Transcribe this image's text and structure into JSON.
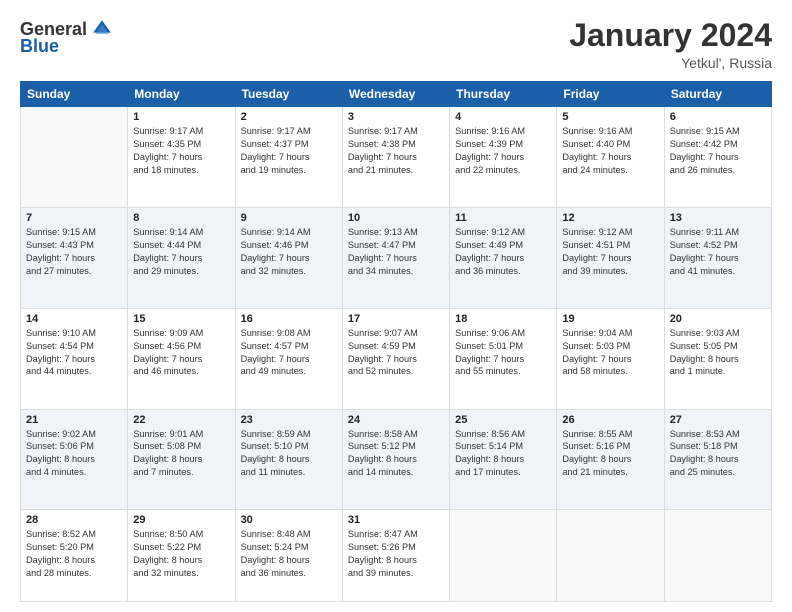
{
  "logo": {
    "general": "General",
    "blue": "Blue"
  },
  "title": "January 2024",
  "location": "Yetkul', Russia",
  "days_header": [
    "Sunday",
    "Monday",
    "Tuesday",
    "Wednesday",
    "Thursday",
    "Friday",
    "Saturday"
  ],
  "weeks": [
    [
      {
        "num": "",
        "info": ""
      },
      {
        "num": "1",
        "info": "Sunrise: 9:17 AM\nSunset: 4:35 PM\nDaylight: 7 hours\nand 18 minutes."
      },
      {
        "num": "2",
        "info": "Sunrise: 9:17 AM\nSunset: 4:37 PM\nDaylight: 7 hours\nand 19 minutes."
      },
      {
        "num": "3",
        "info": "Sunrise: 9:17 AM\nSunset: 4:38 PM\nDaylight: 7 hours\nand 21 minutes."
      },
      {
        "num": "4",
        "info": "Sunrise: 9:16 AM\nSunset: 4:39 PM\nDaylight: 7 hours\nand 22 minutes."
      },
      {
        "num": "5",
        "info": "Sunrise: 9:16 AM\nSunset: 4:40 PM\nDaylight: 7 hours\nand 24 minutes."
      },
      {
        "num": "6",
        "info": "Sunrise: 9:15 AM\nSunset: 4:42 PM\nDaylight: 7 hours\nand 26 minutes."
      }
    ],
    [
      {
        "num": "7",
        "info": "Sunrise: 9:15 AM\nSunset: 4:43 PM\nDaylight: 7 hours\nand 27 minutes."
      },
      {
        "num": "8",
        "info": "Sunrise: 9:14 AM\nSunset: 4:44 PM\nDaylight: 7 hours\nand 29 minutes."
      },
      {
        "num": "9",
        "info": "Sunrise: 9:14 AM\nSunset: 4:46 PM\nDaylight: 7 hours\nand 32 minutes."
      },
      {
        "num": "10",
        "info": "Sunrise: 9:13 AM\nSunset: 4:47 PM\nDaylight: 7 hours\nand 34 minutes."
      },
      {
        "num": "11",
        "info": "Sunrise: 9:12 AM\nSunset: 4:49 PM\nDaylight: 7 hours\nand 36 minutes."
      },
      {
        "num": "12",
        "info": "Sunrise: 9:12 AM\nSunset: 4:51 PM\nDaylight: 7 hours\nand 39 minutes."
      },
      {
        "num": "13",
        "info": "Sunrise: 9:11 AM\nSunset: 4:52 PM\nDaylight: 7 hours\nand 41 minutes."
      }
    ],
    [
      {
        "num": "14",
        "info": "Sunrise: 9:10 AM\nSunset: 4:54 PM\nDaylight: 7 hours\nand 44 minutes."
      },
      {
        "num": "15",
        "info": "Sunrise: 9:09 AM\nSunset: 4:56 PM\nDaylight: 7 hours\nand 46 minutes."
      },
      {
        "num": "16",
        "info": "Sunrise: 9:08 AM\nSunset: 4:57 PM\nDaylight: 7 hours\nand 49 minutes."
      },
      {
        "num": "17",
        "info": "Sunrise: 9:07 AM\nSunset: 4:59 PM\nDaylight: 7 hours\nand 52 minutes."
      },
      {
        "num": "18",
        "info": "Sunrise: 9:06 AM\nSunset: 5:01 PM\nDaylight: 7 hours\nand 55 minutes."
      },
      {
        "num": "19",
        "info": "Sunrise: 9:04 AM\nSunset: 5:03 PM\nDaylight: 7 hours\nand 58 minutes."
      },
      {
        "num": "20",
        "info": "Sunrise: 9:03 AM\nSunset: 5:05 PM\nDaylight: 8 hours\nand 1 minute."
      }
    ],
    [
      {
        "num": "21",
        "info": "Sunrise: 9:02 AM\nSunset: 5:06 PM\nDaylight: 8 hours\nand 4 minutes."
      },
      {
        "num": "22",
        "info": "Sunrise: 9:01 AM\nSunset: 5:08 PM\nDaylight: 8 hours\nand 7 minutes."
      },
      {
        "num": "23",
        "info": "Sunrise: 8:59 AM\nSunset: 5:10 PM\nDaylight: 8 hours\nand 11 minutes."
      },
      {
        "num": "24",
        "info": "Sunrise: 8:58 AM\nSunset: 5:12 PM\nDaylight: 8 hours\nand 14 minutes."
      },
      {
        "num": "25",
        "info": "Sunrise: 8:56 AM\nSunset: 5:14 PM\nDaylight: 8 hours\nand 17 minutes."
      },
      {
        "num": "26",
        "info": "Sunrise: 8:55 AM\nSunset: 5:16 PM\nDaylight: 8 hours\nand 21 minutes."
      },
      {
        "num": "27",
        "info": "Sunrise: 8:53 AM\nSunset: 5:18 PM\nDaylight: 8 hours\nand 25 minutes."
      }
    ],
    [
      {
        "num": "28",
        "info": "Sunrise: 8:52 AM\nSunset: 5:20 PM\nDaylight: 8 hours\nand 28 minutes."
      },
      {
        "num": "29",
        "info": "Sunrise: 8:50 AM\nSunset: 5:22 PM\nDaylight: 8 hours\nand 32 minutes."
      },
      {
        "num": "30",
        "info": "Sunrise: 8:48 AM\nSunset: 5:24 PM\nDaylight: 8 hours\nand 36 minutes."
      },
      {
        "num": "31",
        "info": "Sunrise: 8:47 AM\nSunset: 5:26 PM\nDaylight: 8 hours\nand 39 minutes."
      },
      {
        "num": "",
        "info": ""
      },
      {
        "num": "",
        "info": ""
      },
      {
        "num": "",
        "info": ""
      }
    ]
  ]
}
